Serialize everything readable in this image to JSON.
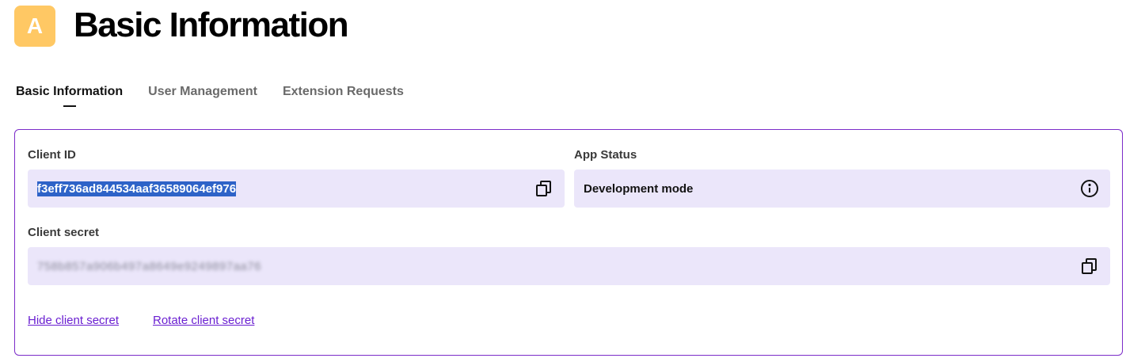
{
  "header": {
    "avatar_letter": "A",
    "title": "Basic Information"
  },
  "tabs": [
    {
      "label": "Basic Information",
      "active": true
    },
    {
      "label": "User Management",
      "active": false
    },
    {
      "label": "Extension Requests",
      "active": false
    }
  ],
  "client_id": {
    "label": "Client ID",
    "value": "f3eff736ad844534aaf36589064ef976",
    "copy_icon": "copy-icon"
  },
  "app_status": {
    "label": "App Status",
    "value": "Development mode",
    "info_icon": "info-icon"
  },
  "client_secret": {
    "label": "Client secret",
    "value": "758b857a906b497a8649e9249897aa76",
    "copy_icon": "copy-icon"
  },
  "links": {
    "hide_secret": "Hide client secret",
    "rotate_secret": "Rotate client secret"
  },
  "colors": {
    "accent": "#7c2cc9",
    "link": "#6a1fd1",
    "field_bg": "#ebe6fa",
    "avatar_bg": "#ffc864"
  }
}
